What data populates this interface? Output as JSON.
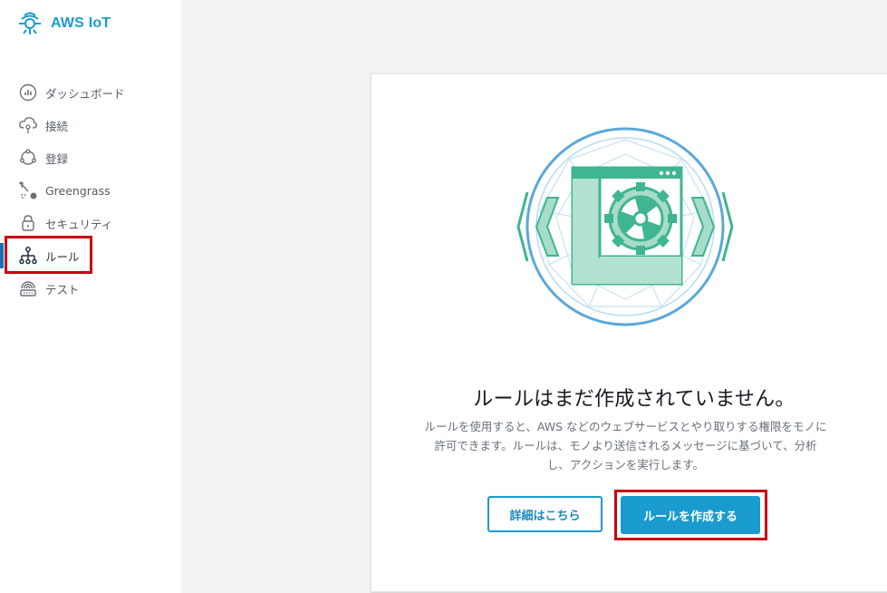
{
  "app": {
    "title": "AWS IoT"
  },
  "sidebar": {
    "items": [
      {
        "label": "ダッシュボード",
        "icon": "dashboard-icon"
      },
      {
        "label": "接続",
        "icon": "cloud-connect-icon"
      },
      {
        "label": "登録",
        "icon": "register-icon"
      },
      {
        "label": "Greengrass",
        "icon": "greengrass-icon"
      },
      {
        "label": "セキュリティ",
        "icon": "lock-icon"
      },
      {
        "label": "ルール",
        "icon": "rules-icon",
        "active": true
      },
      {
        "label": "テスト",
        "icon": "test-icon"
      }
    ]
  },
  "main": {
    "empty_title": "ルールはまだ作成されていません。",
    "empty_desc": "ルールを使用すると、AWS などのウェブサービスとやり取りする権限をモノに許可できます。ルールは、モノより送信されるメッセージに基づいて、分析し、アクションを実行します。",
    "learn_more_label": "詳細はこちら",
    "create_rule_label": "ルールを作成する"
  },
  "colors": {
    "accent": "#1a9bcf",
    "highlight": "#c8000f",
    "illustration_green": "#3fb592",
    "illustration_blue": "#5ba8d9"
  }
}
